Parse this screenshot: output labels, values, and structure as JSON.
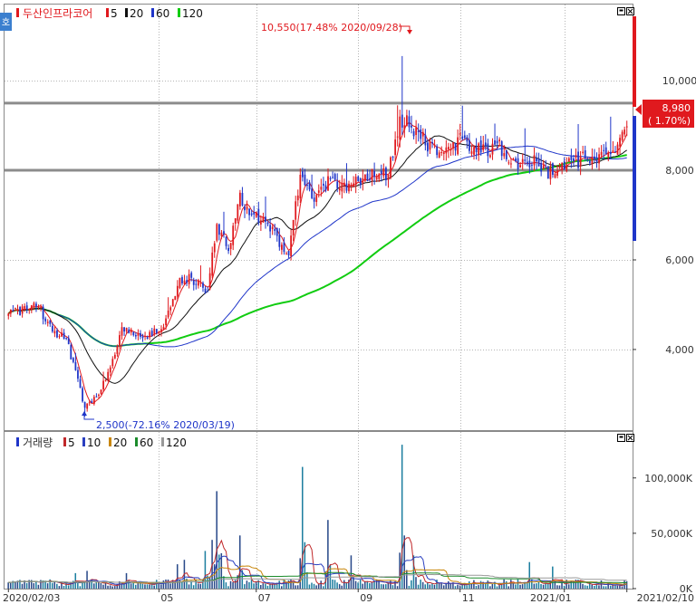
{
  "colors": {
    "up": "#e0191e",
    "down": "#1f35c9",
    "ma5": "#e0191e",
    "ma20": "#111111",
    "ma60": "#1f35c9",
    "ma120": "#11cc11",
    "vma5": "#c0282a",
    "vma10": "#2a3fc0",
    "vma20": "#c8860a",
    "vma60": "#1c8c2c",
    "vma120": "#999999",
    "hline": "#8c8c8c",
    "price_tag": "#e0191e"
  },
  "price_legend": {
    "code": "호",
    "name": "두산인프라코어",
    "items": [
      {
        "label": "5",
        "color": "#e0191e"
      },
      {
        "label": "20",
        "color": "#111111"
      },
      {
        "label": "60",
        "color": "#1f35c9"
      },
      {
        "label": "120",
        "color": "#11cc11"
      }
    ]
  },
  "volume_legend": {
    "name": "거래량",
    "items": [
      {
        "label": "5",
        "color": "#c0282a"
      },
      {
        "label": "10",
        "color": "#2a3fc0"
      },
      {
        "label": "20",
        "color": "#c8860a"
      },
      {
        "label": "60",
        "color": "#1c8c2c"
      },
      {
        "label": "120",
        "color": "#999999"
      }
    ]
  },
  "annotations": {
    "high": "10,550(17.48% 2020/09/28)",
    "low": "2,500(-72.16% 2020/03/19)"
  },
  "current": {
    "price": "8,980",
    "change": "( 1.70%)"
  },
  "chart_data": [
    {
      "type": "candlestick",
      "title": "두산인프라코어",
      "x_range": [
        "2020/02/03",
        "2021/02/10"
      ],
      "ylim": [
        2200,
        11700
      ],
      "y_ticks": [
        "10,000",
        "8,000",
        "6,000",
        "4,000"
      ],
      "y_tick_values": [
        10000,
        8000,
        6000,
        4000
      ],
      "x_tick_labels": [
        "2020/02/03",
        "05",
        "07",
        "09",
        "11",
        "2021/01",
        "2021/02/10"
      ],
      "x_tick_dates": [
        "2020-02-03",
        "2020-05-04",
        "2020-07-01",
        "2020-09-01",
        "2020-11-02",
        "2021-01-04",
        "2021-02-10"
      ],
      "horizontal_lines": [
        9500,
        8000
      ],
      "anchors": [
        {
          "d": "2020-02-03",
          "p": 4800
        },
        {
          "d": "2020-02-20",
          "p": 4950
        },
        {
          "d": "2020-02-28",
          "p": 4400
        },
        {
          "d": "2020-03-09",
          "p": 4250
        },
        {
          "d": "2020-03-19",
          "p": 2700
        },
        {
          "d": "2020-03-26",
          "p": 2950
        },
        {
          "d": "2020-04-03",
          "p": 3600
        },
        {
          "d": "2020-04-10",
          "p": 4500
        },
        {
          "d": "2020-04-24",
          "p": 4300
        },
        {
          "d": "2020-05-06",
          "p": 4500
        },
        {
          "d": "2020-05-15",
          "p": 5600
        },
        {
          "d": "2020-05-22",
          "p": 5600
        },
        {
          "d": "2020-06-02",
          "p": 5300
        },
        {
          "d": "2020-06-08",
          "p": 6800
        },
        {
          "d": "2020-06-15",
          "p": 6200
        },
        {
          "d": "2020-06-22",
          "p": 7500
        },
        {
          "d": "2020-06-26",
          "p": 7000
        },
        {
          "d": "2020-07-08",
          "p": 6800
        },
        {
          "d": "2020-07-21",
          "p": 6100
        },
        {
          "d": "2020-07-28",
          "p": 7900
        },
        {
          "d": "2020-08-05",
          "p": 7300
        },
        {
          "d": "2020-08-14",
          "p": 7800
        },
        {
          "d": "2020-08-26",
          "p": 7700
        },
        {
          "d": "2020-09-04",
          "p": 7900
        },
        {
          "d": "2020-09-18",
          "p": 7900
        },
        {
          "d": "2020-09-25",
          "p": 9200
        },
        {
          "d": "2020-10-08",
          "p": 8700
        },
        {
          "d": "2020-10-20",
          "p": 8400
        },
        {
          "d": "2020-11-03",
          "p": 8700
        },
        {
          "d": "2020-11-13",
          "p": 8400
        },
        {
          "d": "2020-11-24",
          "p": 8600
        },
        {
          "d": "2020-12-04",
          "p": 8200
        },
        {
          "d": "2020-12-17",
          "p": 8200
        },
        {
          "d": "2020-12-28",
          "p": 7900
        },
        {
          "d": "2021-01-08",
          "p": 8200
        },
        {
          "d": "2021-01-20",
          "p": 8300
        },
        {
          "d": "2021-02-03",
          "p": 8400
        },
        {
          "d": "2021-02-10",
          "p": 8980
        }
      ],
      "high_point": {
        "date": "2020-09-28",
        "value": 10550
      },
      "low_point": {
        "date": "2020-03-19",
        "value": 2500
      },
      "ma_windows": [
        5,
        20,
        60,
        120
      ],
      "last_close": 8980,
      "change_pct": 1.7
    },
    {
      "type": "bar",
      "title": "거래량",
      "ylim": [
        0,
        135000
      ],
      "y_ticks": [
        "100,000K",
        "50,000K",
        "0K"
      ],
      "y_tick_values": [
        100000,
        50000,
        0
      ],
      "spikes": [
        {
          "d": "2020-03-13",
          "v": 14000
        },
        {
          "d": "2020-03-20",
          "v": 16000
        },
        {
          "d": "2020-04-14",
          "v": 14000
        },
        {
          "d": "2020-05-14",
          "v": 22000
        },
        {
          "d": "2020-05-19",
          "v": 26000
        },
        {
          "d": "2020-06-01",
          "v": 34000
        },
        {
          "d": "2020-06-04",
          "v": 44000
        },
        {
          "d": "2020-06-08",
          "v": 88000
        },
        {
          "d": "2020-06-10",
          "v": 32000
        },
        {
          "d": "2020-06-22",
          "v": 48000
        },
        {
          "d": "2020-07-29",
          "v": 110000
        },
        {
          "d": "2020-07-30",
          "v": 42000
        },
        {
          "d": "2020-08-13",
          "v": 62000
        },
        {
          "d": "2020-08-27",
          "v": 30000
        },
        {
          "d": "2020-09-28",
          "v": 130000
        },
        {
          "d": "2020-09-29",
          "v": 48000
        },
        {
          "d": "2020-10-05",
          "v": 30000
        },
        {
          "d": "2020-12-14",
          "v": 24000
        },
        {
          "d": "2020-12-28",
          "v": 20000
        }
      ],
      "base_volume": 5000,
      "ma_windows": [
        5,
        10,
        20,
        60,
        120
      ]
    }
  ]
}
